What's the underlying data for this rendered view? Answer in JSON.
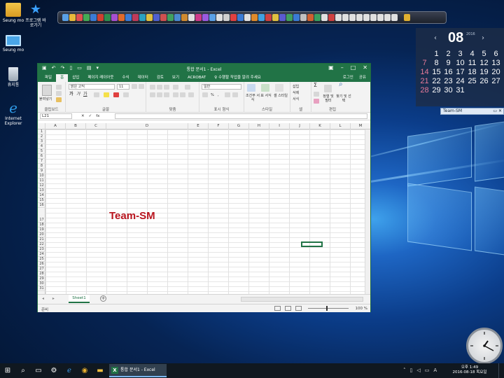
{
  "desktop": {
    "icons": [
      {
        "name": "desktop-icon-user-folder",
        "label": "Seung mo",
        "icon": "user-folder-icon"
      },
      {
        "name": "desktop-icon-shortcut",
        "label": "프로그램 바로가기",
        "icon": "star-shortcut-icon"
      },
      {
        "name": "desktop-icon-this-pc",
        "label": "Seung mo",
        "icon": "computer-icon"
      },
      {
        "name": "desktop-icon-recycle-bin",
        "label": "휴지통",
        "icon": "recycle-bin-icon"
      },
      {
        "name": "desktop-icon-ie",
        "label": "Internet Explorer",
        "icon": "internet-explorer-icon"
      }
    ]
  },
  "calendar": {
    "month": "08",
    "year": "2016",
    "weeks": [
      [
        "",
        "1",
        "2",
        "3",
        "4",
        "5",
        "6"
      ],
      [
        "7",
        "8",
        "9",
        "10",
        "11",
        "12",
        "13"
      ],
      [
        "14",
        "15",
        "16",
        "17",
        "18",
        "19",
        "20"
      ],
      [
        "21",
        "22",
        "23",
        "24",
        "25",
        "26",
        "27"
      ],
      [
        "28",
        "29",
        "30",
        "31",
        "",
        "",
        ""
      ]
    ]
  },
  "gadget": {
    "title": "Team-SM",
    "buttons": "▭ ✕"
  },
  "excel": {
    "title": "통합 문서1 - Excel",
    "tabs": [
      "파일",
      "홈",
      "삽입",
      "페이지 레이아웃",
      "수식",
      "데이터",
      "검토",
      "보기",
      "ACROBAT",
      "♀ 수행할 작업을 알려 주세요"
    ],
    "account": "로그인",
    "share": "공유",
    "ribbon": {
      "clipboard": {
        "label": "클립보드",
        "paste": "붙여넣기"
      },
      "font": {
        "label": "글꼴",
        "family": "맑은 고딕",
        "size": "11"
      },
      "align": {
        "label": "맞춤"
      },
      "number": {
        "label": "표시 형식",
        "format": "일반"
      },
      "styles": {
        "label": "스타일",
        "cond": "조건부 서식",
        "table": "표 서식",
        "cell": "셀 스타일"
      },
      "cells": {
        "label": "셀",
        "insert": "삽입",
        "delete": "삭제",
        "format": "서식"
      },
      "editing": {
        "label": "편집",
        "sort": "정렬 및 필터",
        "find": "찾기 및 선택"
      }
    },
    "namebox": "L21",
    "fx": "fx",
    "columns": [
      "A",
      "B",
      "C",
      "D",
      "E",
      "F",
      "G",
      "H",
      "I",
      "J",
      "K",
      "L",
      "M",
      "N"
    ],
    "rows": [
      "1",
      "2",
      "3",
      "4",
      "5",
      "6",
      "7",
      "8",
      "9",
      "10",
      "11",
      "12",
      "13",
      "14",
      "15",
      "16",
      "17",
      "18",
      "19",
      "20",
      "21",
      "22",
      "23",
      "24",
      "25",
      "26",
      "27",
      "28",
      "29",
      "30",
      "31"
    ],
    "cell_text": "Team-SM",
    "sheet": "Sheet1",
    "status": "준비",
    "zoom": "100 %"
  },
  "taskbar": {
    "excel_label": "통합 문서1 - Excel",
    "time": "오후 1:49",
    "date": "2016-08-18 목요일",
    "ime": "A"
  }
}
